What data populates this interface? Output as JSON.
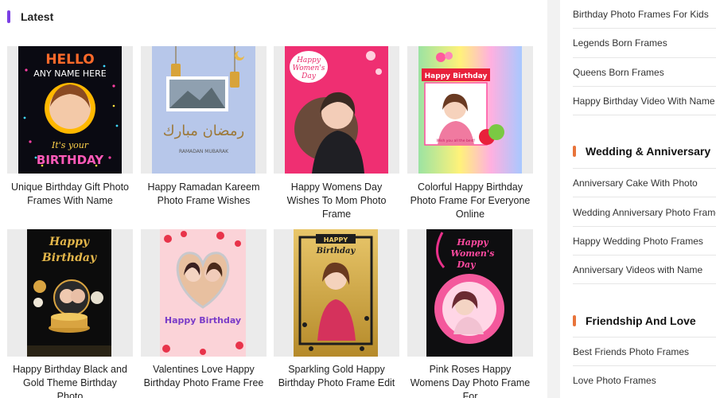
{
  "main": {
    "section_title": "Latest",
    "accent_color": "#7b3fe4",
    "cards": [
      {
        "caption": "Unique Birthday Gift Photo Frames With Name",
        "poster_text": [
          "HELLO",
          "ANY NAME HERE",
          "It's your",
          "BIRTHDAY"
        ]
      },
      {
        "caption": "Happy Ramadan Kareem Photo Frame Wishes",
        "poster_text": [
          "رمضان مبارك",
          "RAMADAN MUBARAK"
        ]
      },
      {
        "caption": "Happy Womens Day Wishes To Mom Photo Frame",
        "poster_text": [
          "Happy",
          "Women's",
          "Day"
        ]
      },
      {
        "caption": "Colorful Happy Birthday Photo Frame For Everyone Online",
        "poster_text": [
          "Happy Birthday",
          "Wish you all the best!"
        ]
      },
      {
        "caption": "Happy Birthday Black and Gold Theme Birthday Photo",
        "poster_text": [
          "Happy",
          "Birthday"
        ]
      },
      {
        "caption": "Valentines Love Happy Birthday Photo Frame Free",
        "poster_text": [
          "Happy Birthday"
        ]
      },
      {
        "caption": "Sparkling Gold Happy Birthday Photo Frame Edit",
        "poster_text": [
          "HAPPY",
          "Birthday"
        ]
      },
      {
        "caption": "Pink Roses Happy Womens Day Photo Frame For",
        "poster_text": [
          "Happy",
          "Women's",
          "Day"
        ]
      }
    ]
  },
  "sidebar": {
    "accent_color": "#e8743b",
    "top_links": [
      "Birthday Photo Frames For Kids",
      "Legends Born Frames",
      "Queens Born Frames",
      "Happy Birthday Video With Name"
    ],
    "sections": [
      {
        "title": "Wedding & Anniversary",
        "links": [
          "Anniversary Cake With Photo",
          "Wedding Anniversary Photo Frames",
          "Happy Wedding Photo Frames",
          "Anniversary Videos with Name"
        ]
      },
      {
        "title": "Friendship And Love",
        "links": [
          "Best Friends Photo Frames",
          "Love Photo Frames"
        ]
      }
    ]
  }
}
